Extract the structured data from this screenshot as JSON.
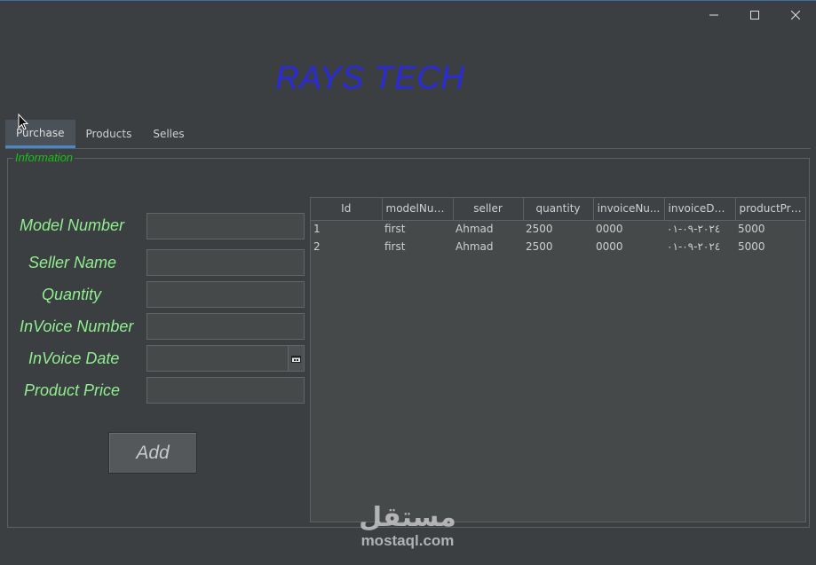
{
  "window": {
    "controls": [
      "minimize-icon",
      "maximize-icon",
      "close-icon"
    ]
  },
  "app": {
    "title": "RAYS TECH"
  },
  "tabs": [
    {
      "label": "Purchase",
      "active": true
    },
    {
      "label": "Products",
      "active": false
    },
    {
      "label": "Selles",
      "active": false
    }
  ],
  "information": {
    "legend": "Information",
    "fields": {
      "model_number": {
        "label": "Model Number",
        "value": ""
      },
      "seller_name": {
        "label": "Seller Name",
        "value": ""
      },
      "quantity": {
        "label": "Quantity",
        "value": ""
      },
      "invoice_number": {
        "label": "InVoice Number",
        "value": ""
      },
      "invoice_date": {
        "label": "InVoice Date",
        "value": ""
      },
      "product_price": {
        "label": "Product Price",
        "value": ""
      }
    },
    "add_label": "Add"
  },
  "table": {
    "columns": [
      "Id",
      "modelNum...",
      "seller",
      "quantity",
      "invoiceNu...",
      "invoiceDate",
      "productPrice"
    ],
    "rows": [
      [
        "1",
        "first",
        "Ahmad",
        "2500",
        "0000",
        "٢٠٢٤-٠٩-٠١",
        "5000"
      ],
      [
        "2",
        "first",
        "Ahmad",
        "2500",
        "0000",
        "٢٠٢٤-٠٩-٠١",
        "5000"
      ]
    ]
  },
  "watermark": {
    "arabic": "مستقل",
    "latin": "mostaql.com"
  },
  "colors": {
    "title": "#2b2bdc",
    "labels": "#90ee90",
    "legend": "#18c018",
    "tab_accent": "#4a88c7"
  }
}
